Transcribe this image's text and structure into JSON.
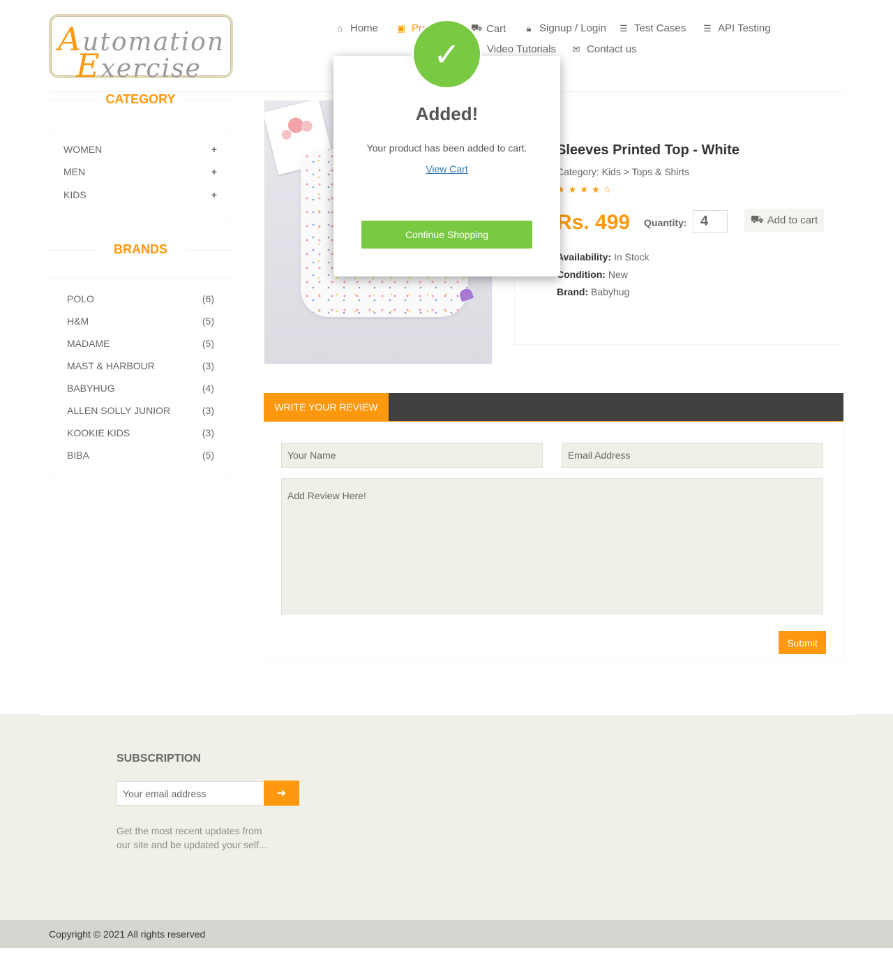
{
  "logo": {
    "line1_cap": "A",
    "line1_rest": "utomation",
    "line2_cap": "E",
    "line2_rest": "xercise"
  },
  "nav": {
    "home": "Home",
    "products": "Products",
    "cart": "Cart",
    "signup": "Signup / Login",
    "test_cases": "Test Cases",
    "api_testing": "API Testing",
    "video_tutorials": "Video Tutorials",
    "contact": "Contact us"
  },
  "sidebar": {
    "category_title": "CATEGORY",
    "categories": [
      "WOMEN",
      "MEN",
      "KIDS"
    ],
    "brands_title": "BRANDS",
    "brands": [
      {
        "name": "POLO",
        "count": "(6)"
      },
      {
        "name": "H&M",
        "count": "(5)"
      },
      {
        "name": "MADAME",
        "count": "(5)"
      },
      {
        "name": "MAST & HARBOUR",
        "count": "(3)"
      },
      {
        "name": "BABYHUG",
        "count": "(4)"
      },
      {
        "name": "ALLEN SOLLY JUNIOR",
        "count": "(3)"
      },
      {
        "name": "KOOKIE KIDS",
        "count": "(3)"
      },
      {
        "name": "BIBA",
        "count": "(5)"
      }
    ]
  },
  "product": {
    "name": "Sleeves Printed Top - White",
    "category": "Category: Kids > Tops & Shirts",
    "rating": 4.5,
    "price": "Rs. 499",
    "quantity_label": "Quantity:",
    "quantity": "4",
    "add_to_cart": "Add to cart",
    "availability_label": "Availability:",
    "availability": "In Stock",
    "condition_label": "Condition:",
    "condition": "New",
    "brand_label": "Brand:",
    "brand": "Babyhug"
  },
  "review": {
    "tab": "WRITE YOUR REVIEW",
    "name_placeholder": "Your Name",
    "email_placeholder": "Email Address",
    "review_placeholder": "Add Review Here!",
    "submit": "Submit"
  },
  "footer": {
    "subscription_title": "SUBSCRIPTION",
    "email_placeholder": "Your email address",
    "subscription_text": "Get the most recent updates from our site and be updated your self...",
    "copyright": "Copyright © 2021 All rights reserved"
  },
  "modal": {
    "title": "Added!",
    "message": "Your product has been added to cart.",
    "view_cart": "View Cart",
    "continue": "Continue Shopping"
  },
  "colors": {
    "accent": "#FE980F",
    "success": "#7AC943",
    "dark_bar": "#40403E",
    "footer_bg": "#F0F0E9"
  },
  "icons": [
    "home-icon",
    "briefcase-icon",
    "cart-icon",
    "lock-icon",
    "list-icon",
    "list-icon",
    "youtube-icon",
    "envelope-icon",
    "plus-icon",
    "star-icon",
    "star-half-icon",
    "check-icon",
    "arrow-circle-right-icon"
  ]
}
